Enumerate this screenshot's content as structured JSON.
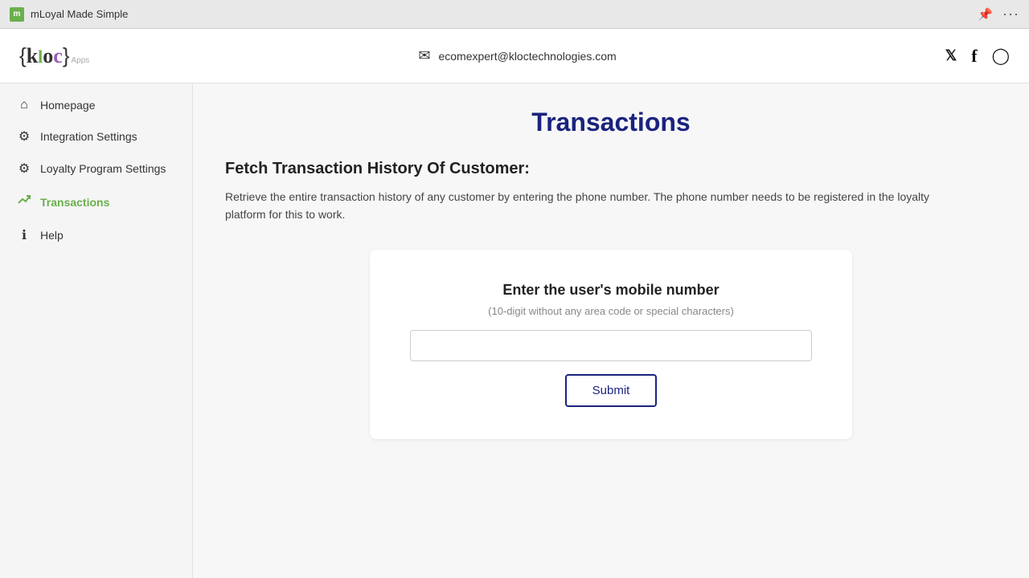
{
  "browser": {
    "title": "mLoyal Made Simple",
    "pin_icon": "📌",
    "dots_icon": "···"
  },
  "header": {
    "logo": {
      "open_bracket": "{",
      "k": "k",
      "l": "l",
      "o": "o",
      "c": "c",
      "close_bracket": "}",
      "apps": "Apps"
    },
    "email": "ecomexpert@kloctechnologies.com",
    "social": {
      "twitter": "𝕏",
      "facebook": "f",
      "instagram": "⊙"
    }
  },
  "sidebar": {
    "items": [
      {
        "id": "homepage",
        "label": "Homepage",
        "icon": "⌂",
        "active": false
      },
      {
        "id": "integration-settings",
        "label": "Integration Settings",
        "icon": "⚙",
        "active": false
      },
      {
        "id": "loyalty-program-settings",
        "label": "Loyalty Program Settings",
        "icon": "⚙",
        "active": false
      },
      {
        "id": "transactions",
        "label": "Transactions",
        "icon": "↗",
        "active": true
      },
      {
        "id": "help",
        "label": "Help",
        "icon": "ℹ",
        "active": false
      }
    ]
  },
  "content": {
    "page_title": "Transactions",
    "section_heading": "Fetch Transaction History Of Customer:",
    "section_description": "Retrieve the entire transaction history of any customer by entering the phone number. The phone number needs to be registered in the loyalty platform for this to work.",
    "card": {
      "title": "Enter the user's mobile number",
      "subtitle": "(10-digit without any area code or special characters)",
      "input_placeholder": "",
      "submit_label": "Submit"
    }
  }
}
